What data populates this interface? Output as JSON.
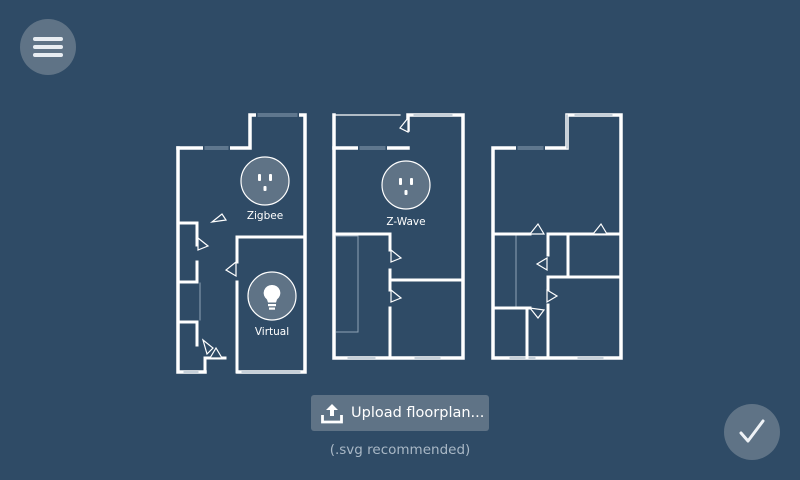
{
  "toolbar": {
    "menu_icon": "hamburger-menu-icon",
    "confirm_icon": "checkmark-icon"
  },
  "floorplans": [
    {
      "id": "plan-1",
      "devices": [
        {
          "type": "outlet",
          "icon": "outlet-icon",
          "label": "Zigbee"
        },
        {
          "type": "bulb",
          "icon": "light-bulb-icon",
          "label": "Virtual"
        }
      ]
    },
    {
      "id": "plan-2",
      "devices": [
        {
          "type": "outlet",
          "icon": "outlet-icon",
          "label": "Z-Wave"
        }
      ]
    },
    {
      "id": "plan-3",
      "devices": []
    }
  ],
  "upload": {
    "icon": "upload-icon",
    "label": "Upload floorplan...",
    "hint": "(.svg recommended)"
  },
  "colors": {
    "background": "#2f4b66",
    "button": "#5f7386",
    "walls": "#ffffff",
    "hint_text": "#a9b8c6"
  }
}
